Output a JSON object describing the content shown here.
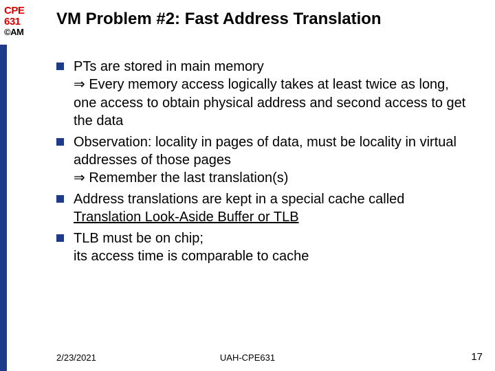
{
  "side": {
    "course_line1": "CPE",
    "course_line2": "631",
    "author": "©AM"
  },
  "title": "VM Problem #2: Fast Address Translation",
  "bullets": [
    {
      "lead": "PTs are stored in main memory",
      "implies": "⇒ ",
      "rest": "Every memory access logically takes at least twice as long, one access to obtain physical address and second access to get the data"
    },
    {
      "lead": "Observation: locality in pages of data, must be locality in virtual addresses of those pages",
      "implies": "⇒ ",
      "rest": "Remember the last translation(s)"
    },
    {
      "lead": "Address translations are kept in a special cache called ",
      "underlined": "Translation Look-Aside Buffer or TLB"
    },
    {
      "lead": "TLB must be on chip;",
      "rest2": "its access time is comparable to cache"
    }
  ],
  "footer": {
    "date": "2/23/2021",
    "center": "UAH-CPE631",
    "page": "17"
  }
}
